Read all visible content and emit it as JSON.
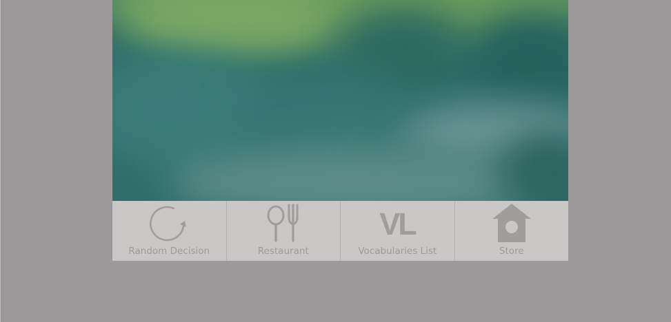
{
  "hero": {
    "description_colors": {
      "top": "#6a9a5e",
      "mid": "#3b7c79",
      "bottom": "#5b8a88"
    }
  },
  "tabbar": {
    "tabs": [
      {
        "label": "Random Decision",
        "icon": "refresh-icon"
      },
      {
        "label": "Restaurant",
        "icon": "spoon-fork-icon"
      },
      {
        "label": "Vocabularies List",
        "icon": "vl-icon",
        "icon_text": "VL"
      },
      {
        "label": "Store",
        "icon": "home-icon"
      }
    ]
  },
  "colors": {
    "overlay": "#9b9999",
    "tabbar_bg": "#c9c8c7",
    "icon": "#a09e9d"
  }
}
